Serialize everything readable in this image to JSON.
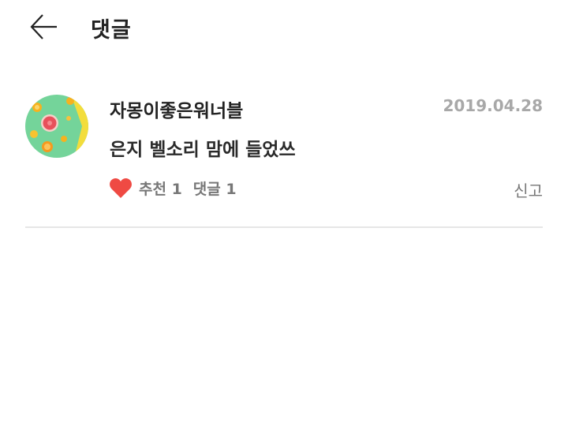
{
  "header": {
    "back_icon": "arrow-left-icon",
    "title": "댓글"
  },
  "comment": {
    "avatar": "citrus-fruit-avatar",
    "username": "자몽이좋은워너블",
    "date": "2019.04.28",
    "text": "은지 벨소리 맘에 들었쓰",
    "like_icon": "heart-icon",
    "like_color": "#ef4a43",
    "recommend_label": "추천 1",
    "reply_label": "댓글 1",
    "report_label": "신고"
  }
}
